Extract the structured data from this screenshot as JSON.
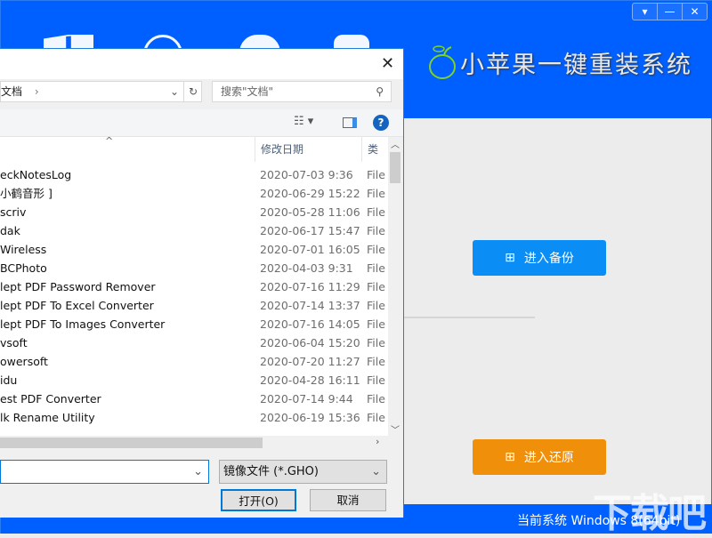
{
  "app": {
    "title": "小苹果一键重装系统",
    "window_buttons": [
      "▾",
      "—",
      "✕"
    ],
    "backup_button": "进入备份",
    "restore_button": "进入还原",
    "status_right": "当前系统 Windows 8(64bit)",
    "watermark": "下载吧",
    "colors": {
      "header": "#0060ff",
      "backup": "#0a8ef5",
      "restore": "#f0900a"
    }
  },
  "dialog": {
    "close": "✕",
    "address": "文档",
    "address_sep": "›",
    "search_placeholder": "搜索\"文档\"",
    "columns": {
      "date": "修改日期",
      "type": "类型"
    },
    "files": [
      {
        "name": "eckNotesLog",
        "date": "2020-07-03 9:36",
        "type": "File"
      },
      {
        "name": "小鹤音形 ]",
        "date": "2020-06-29 15:22",
        "type": "File"
      },
      {
        "name": "scriv",
        "date": "2020-05-28 11:06",
        "type": "File"
      },
      {
        "name": "dak",
        "date": "2020-06-17 15:47",
        "type": "File"
      },
      {
        "name": " Wireless",
        "date": "2020-07-01 16:05",
        "type": "File"
      },
      {
        "name": "BCPhoto",
        "date": "2020-04-03 9:31",
        "type": "File"
      },
      {
        "name": "lept PDF Password Remover",
        "date": "2020-07-16 11:29",
        "type": "File"
      },
      {
        "name": "lept PDF To Excel Converter",
        "date": "2020-07-14 13:37",
        "type": "File"
      },
      {
        "name": "lept PDF To Images Converter",
        "date": "2020-07-16 14:05",
        "type": "File"
      },
      {
        "name": "vsoft",
        "date": "2020-06-04 15:20",
        "type": "File"
      },
      {
        "name": "owersoft",
        "date": "2020-07-20 11:27",
        "type": "File"
      },
      {
        "name": "idu",
        "date": "2020-04-28 16:11",
        "type": "File"
      },
      {
        "name": "est PDF Converter",
        "date": "2020-07-14 9:44",
        "type": "File"
      },
      {
        "name": "lk Rename Utility",
        "date": "2020-06-19 15:36",
        "type": "File"
      }
    ],
    "filename_value": "",
    "filter": "镜像文件 (*.GHO)",
    "open_button": "打开(O)",
    "cancel_button": "取消"
  }
}
